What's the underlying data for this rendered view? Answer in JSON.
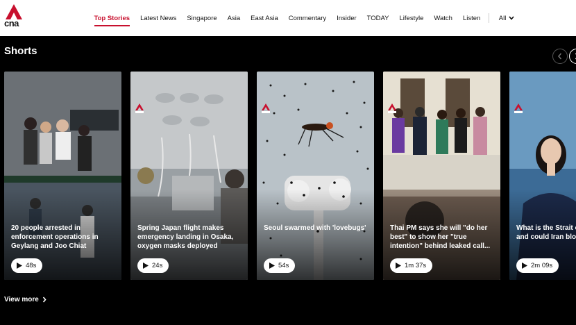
{
  "header": {
    "logo_text": "cna",
    "nav": [
      {
        "label": "Top Stories",
        "active": true
      },
      {
        "label": "Latest News"
      },
      {
        "label": "Singapore"
      },
      {
        "label": "Asia"
      },
      {
        "label": "East Asia"
      },
      {
        "label": "Commentary"
      },
      {
        "label": "Insider"
      },
      {
        "label": "TODAY"
      },
      {
        "label": "Lifestyle"
      },
      {
        "label": "Watch"
      },
      {
        "label": "Listen"
      }
    ],
    "all_label": "All"
  },
  "shorts": {
    "title": "Shorts",
    "cards": [
      {
        "title": "20 people arrested in enforcement operations in Geylang and Joo Chiat",
        "duration": "48s"
      },
      {
        "title": "Spring Japan flight makes emergency landing in Osaka, oxygen masks deployed",
        "duration": "24s"
      },
      {
        "title": "Seoul swarmed with 'lovebugs'",
        "duration": "54s"
      },
      {
        "title": "Thai PM says she will \"do her best\" to show her \"true intention\" behind leaked call...",
        "duration": "1m 37s"
      },
      {
        "title": "What is the Strait of Hormuz and could Iran block it?",
        "duration": "2m 09s"
      }
    ],
    "view_more": "View more"
  },
  "colors": {
    "brand": "#c8102e",
    "background": "#000000"
  },
  "icons": [
    "cna-logo-icon",
    "chevron-down-icon",
    "chevron-left-icon",
    "chevron-right-icon",
    "play-icon"
  ]
}
